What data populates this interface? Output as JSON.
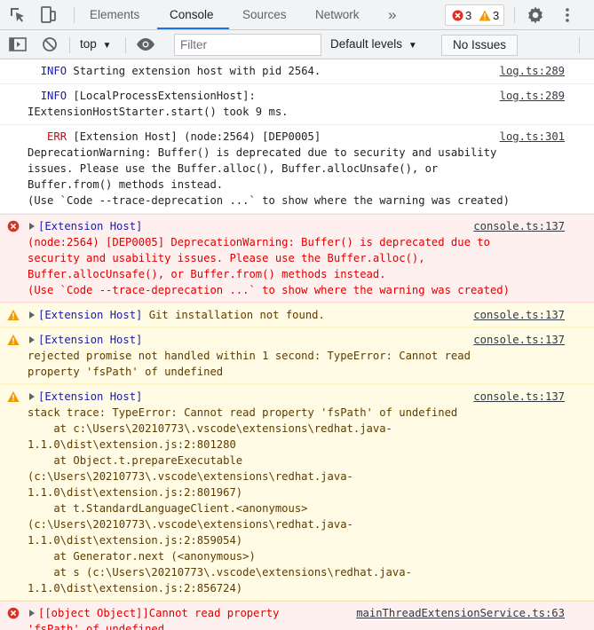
{
  "tabs": {
    "elements": "Elements",
    "console": "Console",
    "sources": "Sources",
    "network": "Network",
    "more": "»"
  },
  "counters": {
    "errors": "3",
    "warnings": "3"
  },
  "toolbar": {
    "context": "top",
    "filter_placeholder": "Filter",
    "levels": "Default levels",
    "issues": "No Issues"
  },
  "colors": {
    "accent": "#1a73e8",
    "error": "#dd0000",
    "warning": "#f29900",
    "info_tag": "#1a1aa6"
  },
  "messages": [
    {
      "level": "info",
      "source": "log.ts:289",
      "lines": [
        "  INFO Starting extension host with pid 2564."
      ]
    },
    {
      "level": "info",
      "source": "log.ts:289",
      "lines": [
        "  INFO [LocalProcessExtensionHost]:",
        "IExtensionHostStarter.start() took 9 ms."
      ]
    },
    {
      "level": "info",
      "source": "log.ts:301",
      "lines": [
        "   ERR [Extension Host] (node:2564) [DEP0005]",
        "DeprecationWarning: Buffer() is deprecated due to security and usability",
        "issues. Please use the Buffer.alloc(), Buffer.allocUnsafe(), or",
        "Buffer.from() methods instead.",
        "(Use `Code --trace-deprecation ...` to show where the warning was created)"
      ]
    },
    {
      "level": "error",
      "source": "console.ts:137",
      "head": "[Extension Host]",
      "head_rest": "",
      "lines": [
        "(node:2564) [DEP0005] DeprecationWarning: Buffer() is deprecated due to",
        "security and usability issues. Please use the Buffer.alloc(),",
        "Buffer.allocUnsafe(), or Buffer.from() methods instead.",
        "(Use `Code --trace-deprecation ...` to show where the warning was created)"
      ]
    },
    {
      "level": "warning",
      "source": "console.ts:137",
      "head": "[Extension Host]",
      "head_rest": " Git installation not found.",
      "lines": []
    },
    {
      "level": "warning",
      "source": "console.ts:137",
      "head": "[Extension Host]",
      "head_rest": "",
      "lines": [
        "rejected promise not handled within 1 second: TypeError: Cannot read",
        "property 'fsPath' of undefined"
      ]
    },
    {
      "level": "warning",
      "source": "console.ts:137",
      "head": "[Extension Host]",
      "head_rest": "",
      "lines": [
        "stack trace: TypeError: Cannot read property 'fsPath' of undefined",
        "    at c:\\Users\\20210773\\.vscode\\extensions\\redhat.java-",
        "1.1.0\\dist\\extension.js:2:801280",
        "    at Object.t.prepareExecutable",
        "(c:\\Users\\20210773\\.vscode\\extensions\\redhat.java-",
        "1.1.0\\dist\\extension.js:2:801967)",
        "    at t.StandardLanguageClient.<anonymous>",
        "(c:\\Users\\20210773\\.vscode\\extensions\\redhat.java-",
        "1.1.0\\dist\\extension.js:2:859054)",
        "    at Generator.next (<anonymous>)",
        "    at s (c:\\Users\\20210773\\.vscode\\extensions\\redhat.java-",
        "1.1.0\\dist\\extension.js:2:856724)"
      ]
    },
    {
      "level": "error",
      "source": "mainThreadExtensionService.ts:63",
      "head": "",
      "head_rest": "[[object Object]]Cannot read property",
      "lines": [
        "'fsPath' of undefined"
      ]
    }
  ]
}
